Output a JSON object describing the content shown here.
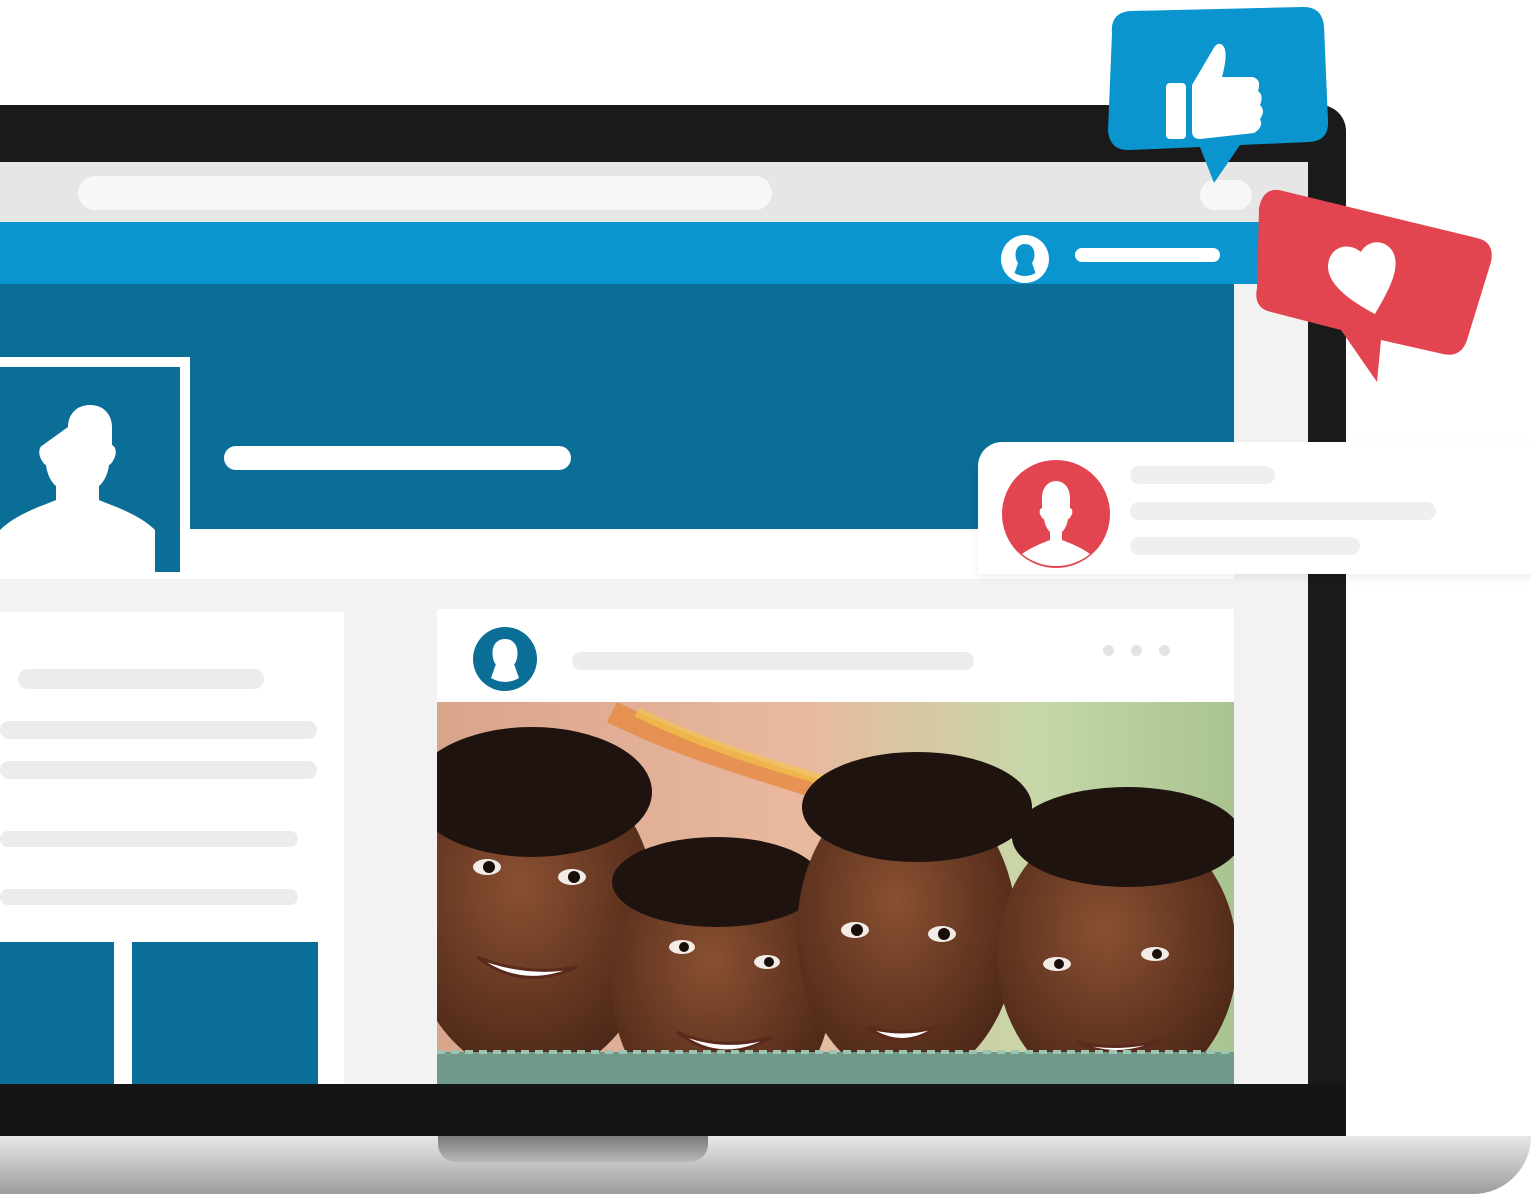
{
  "scene": {
    "description_free": true
  },
  "icons": {
    "nav_avatar": "user-avatar-icon",
    "profile_picture": "person-silhouette-icon",
    "post_avatar": "user-avatar-icon",
    "notification_avatar": "person-silhouette-icon",
    "like_reaction": "thumbs-up-icon",
    "love_reaction": "heart-icon",
    "post_menu": "more-dots-icon"
  },
  "colors": {
    "nav_blue": "#0a95cf",
    "cover_blue": "#0b6e96",
    "like_blue": "#0a95cf",
    "love_red": "#e34550"
  }
}
